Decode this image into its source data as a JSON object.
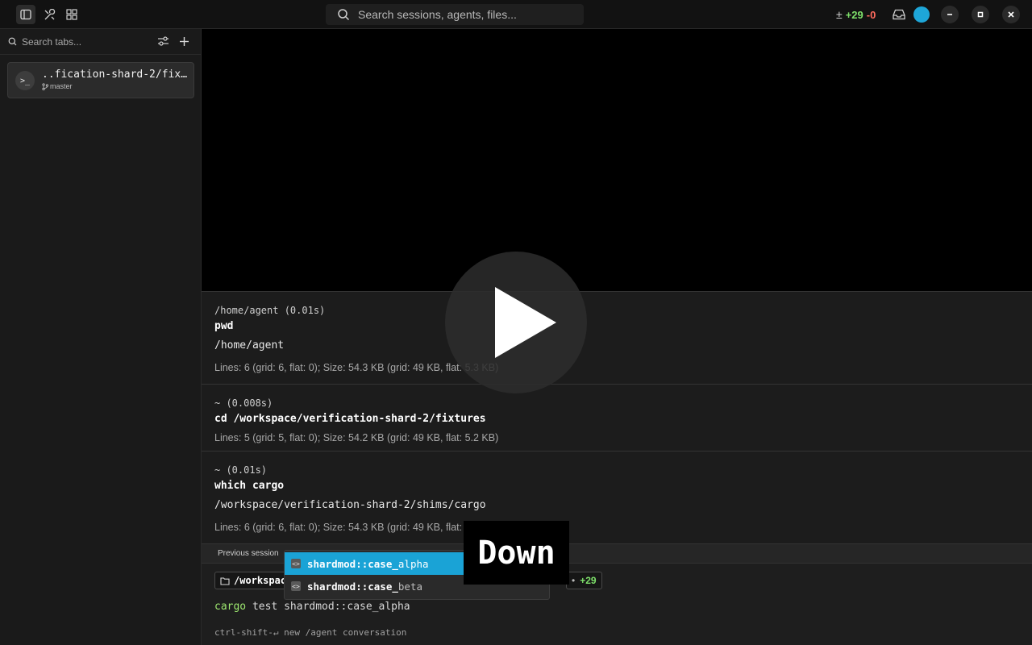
{
  "titlebar": {
    "search_placeholder": "Search sessions, agents, files...",
    "diff": {
      "symbol": "±",
      "added": "+29",
      "removed": "-0"
    },
    "avatar_color": "#1ea6d8"
  },
  "sidebar": {
    "search_placeholder": "Search tabs...",
    "tabs": [
      {
        "title": "..fication-shard-2/fixtures",
        "branch": "master"
      }
    ]
  },
  "blocks": [
    {
      "dir": "/home/agent (0.01s)",
      "command": "pwd",
      "output": "/home/agent",
      "lines": "Lines: 6 (grid: 6, flat: 0); Size: 54.3 KB (grid: 49 KB, flat: 5.3 KB)"
    },
    {
      "dir": "~ (0.008s)",
      "command": "cd /workspace/verification-shard-2/fixtures",
      "output": "",
      "lines": "Lines: 5 (grid: 5, flat: 0); Size: 54.2 KB (grid: 49 KB, flat: 5.2 KB)"
    },
    {
      "dir": "~ (0.01s)",
      "command": "which cargo",
      "output": "/workspace/verification-shard-2/shims/cargo",
      "lines": "Lines: 6 (grid: 6, flat: 0); Size: 54.3 KB (grid: 49 KB, flat:"
    }
  ],
  "previous_session": {
    "label": "Previous session"
  },
  "input": {
    "cwd_chip": "/workspac",
    "diff_chip": {
      "dot": "•",
      "added": "+29"
    },
    "command": "cargo",
    "args": "test shardmod::case_alpha",
    "hint": "ctrl-shift-↵ new /agent conversation"
  },
  "autocomplete": [
    {
      "prefix": "shardmod::case_",
      "suffix": "alpha",
      "selected": true
    },
    {
      "prefix": "shardmod::case_",
      "suffix": "beta",
      "selected": false
    }
  ],
  "key_overlay": {
    "key": "Down"
  }
}
